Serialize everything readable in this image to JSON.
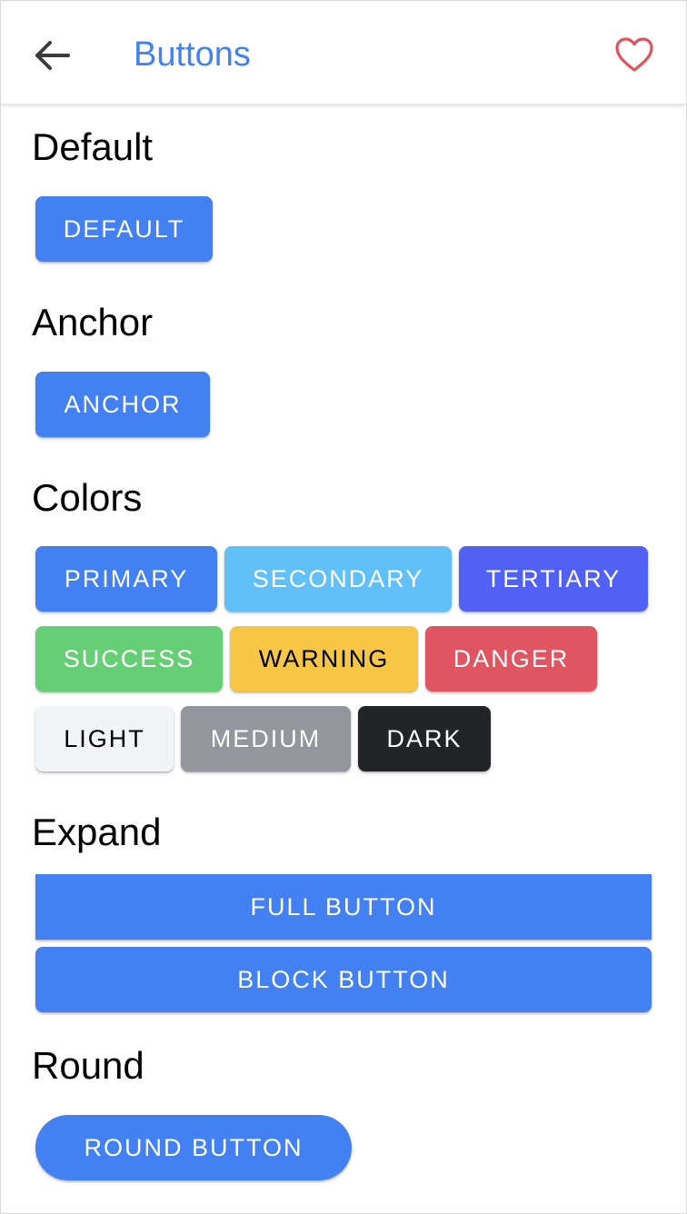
{
  "toolbar": {
    "title": "Buttons",
    "back_icon": "arrow-back-icon",
    "favorite_icon": "heart-outline-icon",
    "title_color": "#3f82f0",
    "favorite_color": "#e0525d"
  },
  "sections": {
    "default": {
      "heading": "Default",
      "button": "DEFAULT"
    },
    "anchor": {
      "heading": "Anchor",
      "button": "ANCHOR"
    },
    "colors": {
      "heading": "Colors",
      "buttons": [
        {
          "label": "PRIMARY",
          "bg": "#4380f2",
          "fg": "#ffffff"
        },
        {
          "label": "SECONDARY",
          "bg": "#62c0f8",
          "fg": "#ffffff"
        },
        {
          "label": "TERTIARY",
          "bg": "#5261f5",
          "fg": "#ffffff"
        },
        {
          "label": "SUCCESS",
          "bg": "#66cf76",
          "fg": "#ffffff"
        },
        {
          "label": "WARNING",
          "bg": "#f6c644",
          "fg": "#000000"
        },
        {
          "label": "DANGER",
          "bg": "#e05562",
          "fg": "#ffffff"
        },
        {
          "label": "LIGHT",
          "bg": "#f3f4f7",
          "fg": "#000000"
        },
        {
          "label": "MEDIUM",
          "bg": "#93969c",
          "fg": "#ffffff"
        },
        {
          "label": "DARK",
          "bg": "#222428",
          "fg": "#ffffff"
        }
      ]
    },
    "expand": {
      "heading": "Expand",
      "full_button": "FULL BUTTON",
      "block_button": "BLOCK BUTTON"
    },
    "round": {
      "heading": "Round",
      "button": "ROUND BUTTON"
    }
  },
  "primary_color": "#4380f2"
}
